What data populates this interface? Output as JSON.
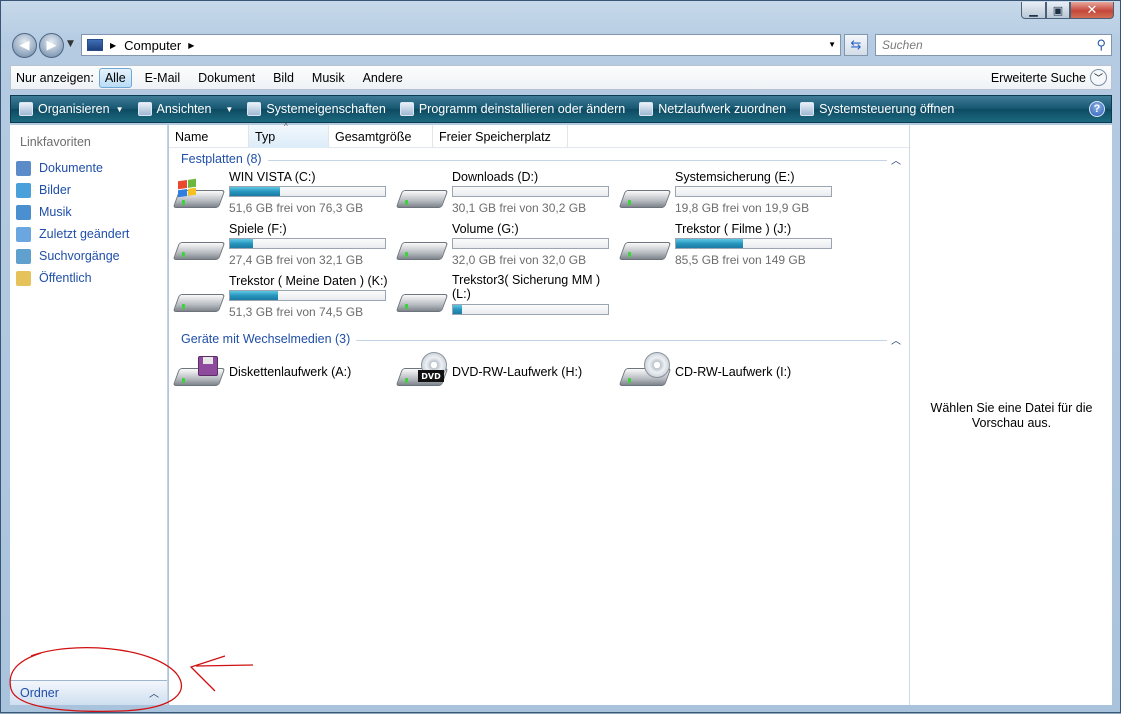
{
  "window": {
    "caption_buttons": [
      {
        "name": "minimize",
        "glyph": "▁"
      },
      {
        "name": "maximize",
        "glyph": "▣"
      },
      {
        "name": "close",
        "glyph": "✕"
      }
    ]
  },
  "address": {
    "back_glyph": "◀",
    "forward_glyph": "▶",
    "path": "Computer",
    "search_placeholder": "Suchen"
  },
  "filter": {
    "label": "Nur anzeigen:",
    "items": [
      "Alle",
      "E-Mail",
      "Dokument",
      "Bild",
      "Musik",
      "Andere"
    ],
    "selected": "Alle",
    "advanced": "Erweiterte Suche"
  },
  "commands": [
    {
      "label": "Organisieren",
      "dropdown": true
    },
    {
      "label": "Ansichten",
      "dropdown": true
    },
    {
      "label": "Systemeigenschaften"
    },
    {
      "label": "Programm deinstallieren oder ändern"
    },
    {
      "label": "Netzlaufwerk zuordnen"
    },
    {
      "label": "Systemsteuerung öffnen"
    }
  ],
  "nav": {
    "section": "Linkfavoriten",
    "items": [
      {
        "label": "Dokumente",
        "icon": "documents-icon",
        "color": "#5b8cc9"
      },
      {
        "label": "Bilder",
        "icon": "pictures-icon",
        "color": "#4aa0d8"
      },
      {
        "label": "Musik",
        "icon": "music-icon",
        "color": "#4a8fcf"
      },
      {
        "label": "Zuletzt geändert",
        "icon": "recent-icon",
        "color": "#6aa6e0"
      },
      {
        "label": "Suchvorgänge",
        "icon": "searches-icon",
        "color": "#5fa0cf"
      },
      {
        "label": "Öffentlich",
        "icon": "folder-icon",
        "color": "#e6c35a"
      }
    ],
    "folders_label": "Ordner"
  },
  "columns": [
    "Name",
    "Typ",
    "Gesamtgröße",
    "Freier Speicherplatz"
  ],
  "groups": {
    "hard_disks": {
      "title": "Festplatten (8)",
      "drives": [
        {
          "name": "WIN VISTA (C:)",
          "free": "51,6 GB frei von 76,3 GB",
          "used_fraction": 0.32,
          "system": true
        },
        {
          "name": "Downloads (D:)",
          "free": "30,1 GB frei von 30,2 GB",
          "used_fraction": 0.0
        },
        {
          "name": "Systemsicherung (E:)",
          "free": "19,8 GB frei von 19,9 GB",
          "used_fraction": 0.0
        },
        {
          "name": "Spiele (F:)",
          "free": "27,4 GB frei von 32,1 GB",
          "used_fraction": 0.15
        },
        {
          "name": "Volume (G:)",
          "free": "32,0 GB frei von 32,0 GB",
          "used_fraction": 0.0
        },
        {
          "name": "Trekstor ( Filme ) (J:)",
          "free": "85,5 GB frei von 149 GB",
          "used_fraction": 0.43
        },
        {
          "name": "Trekstor ( Meine Daten ) (K:)",
          "free": "51,3 GB frei von 74,5 GB",
          "used_fraction": 0.31
        },
        {
          "name": "Trekstor3( Sicherung MM ) (L:)",
          "free": "",
          "used_fraction": 0.06
        }
      ]
    },
    "removable": {
      "title": "Geräte mit Wechselmedien (3)",
      "drives": [
        {
          "name": "Diskettenlaufwerk (A:)",
          "kind": "floppy"
        },
        {
          "name": "DVD-RW-Laufwerk (H:)",
          "kind": "dvd",
          "badge": "DVD"
        },
        {
          "name": "CD-RW-Laufwerk (I:)",
          "kind": "cd"
        }
      ]
    }
  },
  "preview": {
    "message": "Wählen Sie eine Datei für die Vorschau aus."
  },
  "colors": {
    "link": "#1f4fa8",
    "command_bar": "#16566f",
    "progress": "#2896bd",
    "annotation": "#d01010"
  }
}
